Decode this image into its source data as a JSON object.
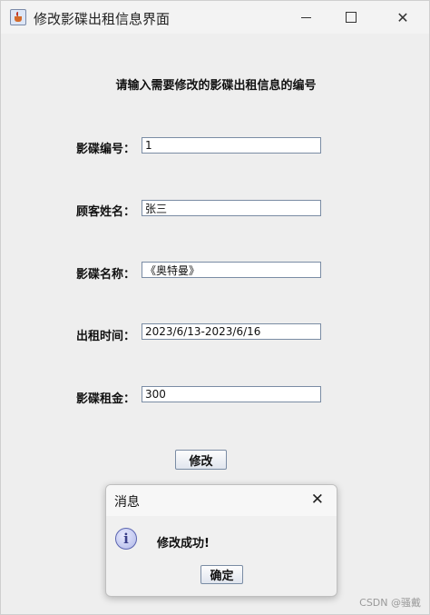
{
  "window": {
    "title": "修改影碟出租信息界面",
    "minimize_glyph": "",
    "maximize_glyph": "",
    "close_glyph": "✕"
  },
  "form": {
    "header": "请输入需要修改的影碟出租信息的编号",
    "fields": [
      {
        "label": "影碟编号：",
        "value": "1"
      },
      {
        "label": "顾客姓名：",
        "value": "张三"
      },
      {
        "label": "影碟名称：",
        "value": "《奥特曼》"
      },
      {
        "label": "出租时间：",
        "value": "2023/6/13-2023/6/16"
      },
      {
        "label": "影碟租金：",
        "value": "300"
      }
    ],
    "submit_label": "修改"
  },
  "dialog": {
    "title": "消息",
    "close_glyph": "✕",
    "icon": "info-icon",
    "icon_glyph": "i",
    "message": "修改成功!",
    "ok_label": "确定"
  },
  "watermark": "CSDN @骚戴"
}
